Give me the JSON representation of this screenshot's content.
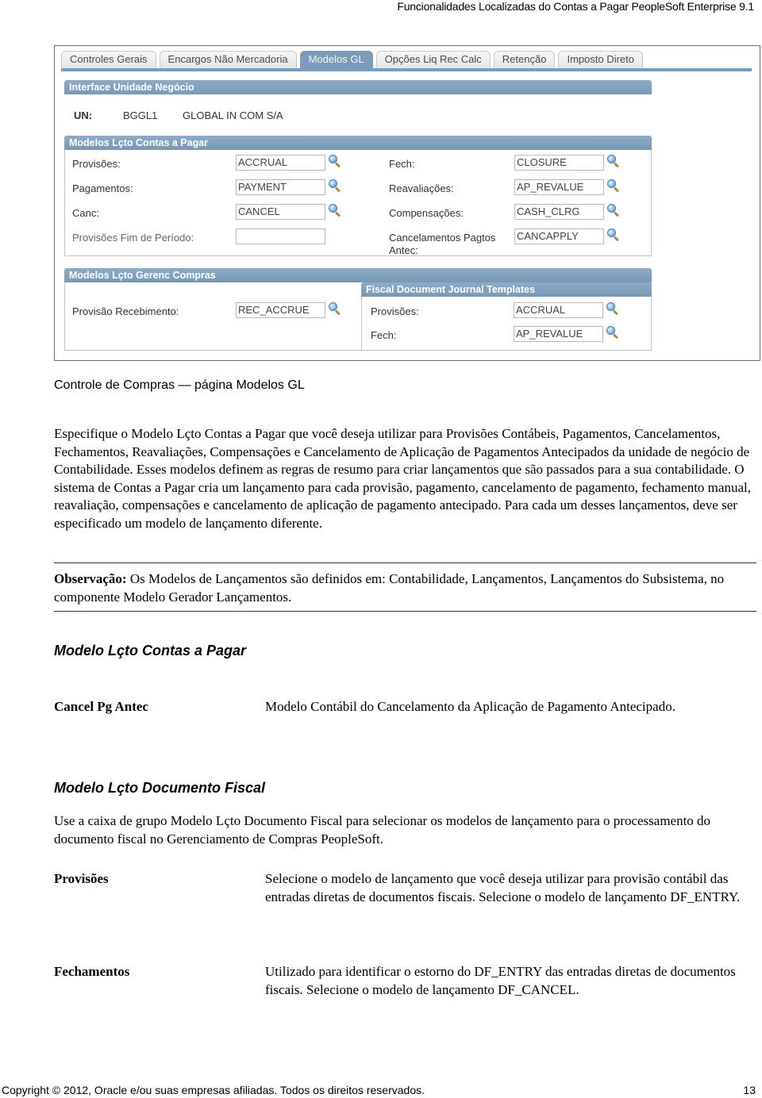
{
  "page_header": "Funcionalidades Localizadas do Contas a Pagar PeopleSoft Enterprise 9.1",
  "screenshot": {
    "tabs": [
      {
        "label": "Controles Gerais",
        "active": false
      },
      {
        "label": "Encargos Não Mercadoria",
        "active": false
      },
      {
        "label": "Modelos GL",
        "active": true
      },
      {
        "label": "Opções Liq Rec Calc",
        "active": false
      },
      {
        "label": "Retenção",
        "active": false
      },
      {
        "label": "Imposto Direto",
        "active": false
      }
    ],
    "interface_section": {
      "title": "Interface Unidade Negócio",
      "un_label": "UN:",
      "un_code": "BGGL1",
      "un_name": "GLOBAL IN COM S/A"
    },
    "ap_section": {
      "title": "Modelos Lçto Contas a Pagar",
      "left": [
        {
          "label": "Provisões:",
          "value": "ACCRUAL"
        },
        {
          "label": "Pagamentos:",
          "value": "PAYMENT"
        },
        {
          "label": "Canc:",
          "value": "CANCEL"
        },
        {
          "label": "Provisões Fim de Período:",
          "value": ""
        }
      ],
      "right": [
        {
          "label": "Fech:",
          "value": "CLOSURE"
        },
        {
          "label": "Reavaliações:",
          "value": "AP_REVALUE"
        },
        {
          "label": "Compensações:",
          "value": "CASH_CLRG"
        },
        {
          "label": "Cancelamentos Pagtos Antec:",
          "value": "CANCAPPLY"
        }
      ]
    },
    "purchasing_section": {
      "title": "Modelos Lçto Gerenc Compras",
      "receipt_label": "Provisão Recebimento:",
      "receipt_value": "REC_ACCRUE",
      "fiscal": {
        "title": "Fiscal Document Journal Templates",
        "accrual_label": "Provisões:",
        "accrual_value": "ACCRUAL",
        "closure_label": "Fech:",
        "closure_value": "AP_REVALUE"
      }
    }
  },
  "caption": "Controle de Compras — página Modelos GL",
  "intro": "Especifique o Modelo Lçto Contas a Pagar que você deseja utilizar para Provisões Contábeis, Pagamentos, Cancelamentos, Fechamentos, Reavaliações, Compensações e Cancelamento de Aplicação de Pagamentos Antecipados da unidade de negócio de Contabilidade. Esses modelos definem as regras de resumo para criar lançamentos que são passados para a sua contabilidade. O sistema de Contas a Pagar cria um lançamento para cada provisão, pagamento, cancelamento de pagamento, fechamento manual, reavaliação, compensações e cancelamento de aplicação de pagamento antecipado. Para cada um desses lançamentos, deve ser especificado um modelo de lançamento diferente.",
  "note": {
    "label": "Observação:",
    "text": " Os Modelos de Lançamentos são definidos em: Contabilidade, Lançamentos, Lançamentos do Subsistema, no componente Modelo Gerador Lançamentos."
  },
  "section1": {
    "heading": "Modelo Lçto Contas a Pagar",
    "terms": [
      {
        "term": "Cancel Pg Antec",
        "definition": "Modelo Contábil do Cancelamento da Aplicação de Pagamento Antecipado."
      }
    ]
  },
  "section2": {
    "heading": "Modelo Lçto Documento Fiscal",
    "intro": "Use a caixa de grupo Modelo Lçto Documento Fiscal para selecionar os modelos de lançamento para o processamento do documento fiscal no Gerenciamento de Compras PeopleSoft.",
    "terms": [
      {
        "term": "Provisões",
        "definition": "Selecione o modelo de lançamento que você deseja utilizar para provisão contábil das entradas diretas de documentos fiscais. Selecione o modelo de lançamento DF_ENTRY."
      },
      {
        "term": "Fechamentos",
        "definition": "Utilizado para identificar o estorno do DF_ENTRY das entradas diretas de documentos fiscais. Selecione o modelo de lançamento DF_CANCEL."
      }
    ]
  },
  "footer": {
    "copyright": "Copyright © 2012, Oracle e/ou suas empresas afiliadas. Todos os direitos reservados.",
    "page_number": "13"
  }
}
